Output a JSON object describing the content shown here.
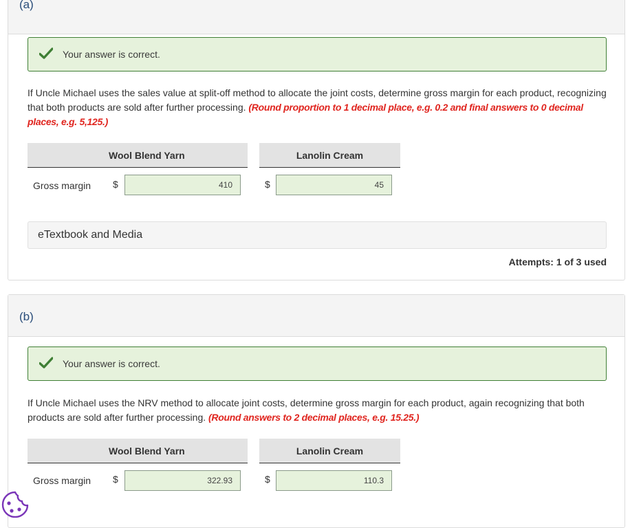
{
  "part_a": {
    "label": "(a)",
    "status_text": "Your answer is correct.",
    "question_text": "If Uncle Michael uses the sales value at split-off method to allocate the joint costs, determine gross margin for each product, recognizing that both products are sold after further processing.",
    "question_hint": "(Round proportion to 1 decimal place, e.g. 0.2 and final answers to 0 decimal places, e.g. 5,125.)",
    "columns": [
      "Wool Blend Yarn",
      "Lanolin Cream"
    ],
    "row_label": "Gross margin",
    "currency": "$",
    "values": [
      "410",
      "45"
    ],
    "etextbook_label": "eTextbook and Media",
    "attempts_text": "Attempts: 1 of 3 used"
  },
  "part_b": {
    "label": "(b)",
    "status_text": "Your answer is correct.",
    "question_text": "If Uncle Michael uses the NRV method to allocate joint costs, determine gross margin for each product, again recognizing that both products are sold after further processing.",
    "question_hint": "(Round answers to 2 decimal places, e.g. 15.25.)",
    "columns": [
      "Wool Blend Yarn",
      "Lanolin Cream"
    ],
    "row_label": "Gross margin",
    "currency": "$",
    "values": [
      "322.93",
      "110.3"
    ]
  },
  "colors": {
    "correct_bg": "#e6f2dc",
    "correct_border": "#3f7f35",
    "hint_red": "#e0251f",
    "part_label_blue": "#2a4d7a"
  },
  "icons": [
    "check-icon",
    "cookie-icon"
  ]
}
